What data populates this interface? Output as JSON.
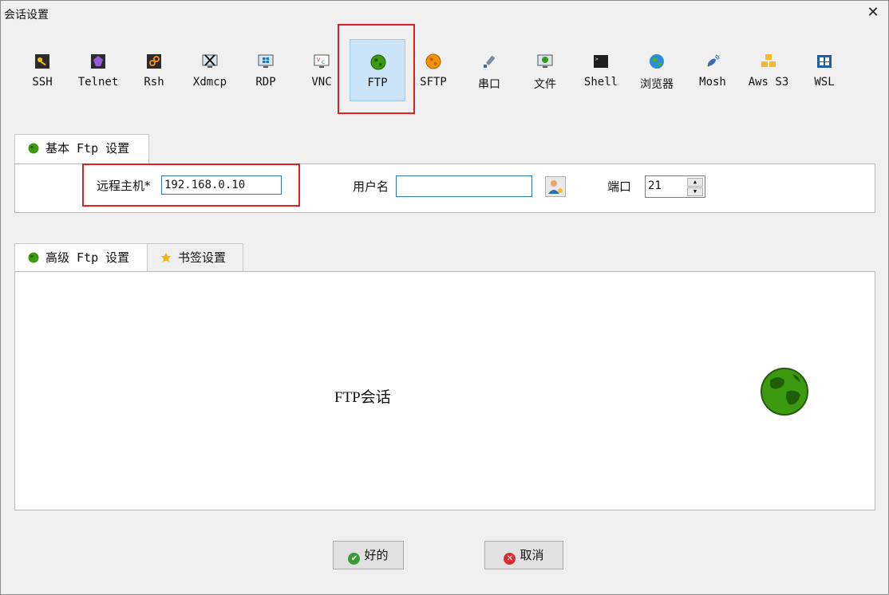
{
  "window": {
    "title": "会话设置",
    "close_symbol": "✕"
  },
  "session_types": [
    {
      "label": "SSH",
      "icon": "key-icon"
    },
    {
      "label": "Telnet",
      "icon": "telnet-icon"
    },
    {
      "label": "Rsh",
      "icon": "rsh-icon"
    },
    {
      "label": "Xdmcp",
      "icon": "x-monitor-icon"
    },
    {
      "label": "RDP",
      "icon": "windows-monitor-icon"
    },
    {
      "label": "VNC",
      "icon": "vnc-monitor-icon"
    },
    {
      "label": "FTP",
      "icon": "globe-icon",
      "selected": true
    },
    {
      "label": "SFTP",
      "icon": "orange-globe-icon"
    },
    {
      "label": "串口",
      "icon": "plug-icon"
    },
    {
      "label": "文件",
      "icon": "file-monitor-icon"
    },
    {
      "label": "Shell",
      "icon": "terminal-icon"
    },
    {
      "label": "浏览器",
      "icon": "earth-icon"
    },
    {
      "label": "Mosh",
      "icon": "satellite-icon"
    },
    {
      "label": "Aws S3",
      "icon": "cubes-icon"
    },
    {
      "label": "WSL",
      "icon": "windows-icon"
    }
  ],
  "basic_tab": {
    "label": "基本 Ftp 设置"
  },
  "basic": {
    "remote_host_label": "远程主机*",
    "remote_host_value": "192.168.0.10",
    "username_label": "用户名",
    "username_value": "",
    "port_label": "端口",
    "port_value": "21"
  },
  "lower_tabs": {
    "advanced": "高级 Ftp 设置",
    "bookmark": "书签设置"
  },
  "description": "FTP会话",
  "buttons": {
    "ok": "好的",
    "cancel": "取消"
  },
  "colors": {
    "accent": "#cce4f7",
    "highlight": "#e02020",
    "globe": "#3c9a10"
  }
}
